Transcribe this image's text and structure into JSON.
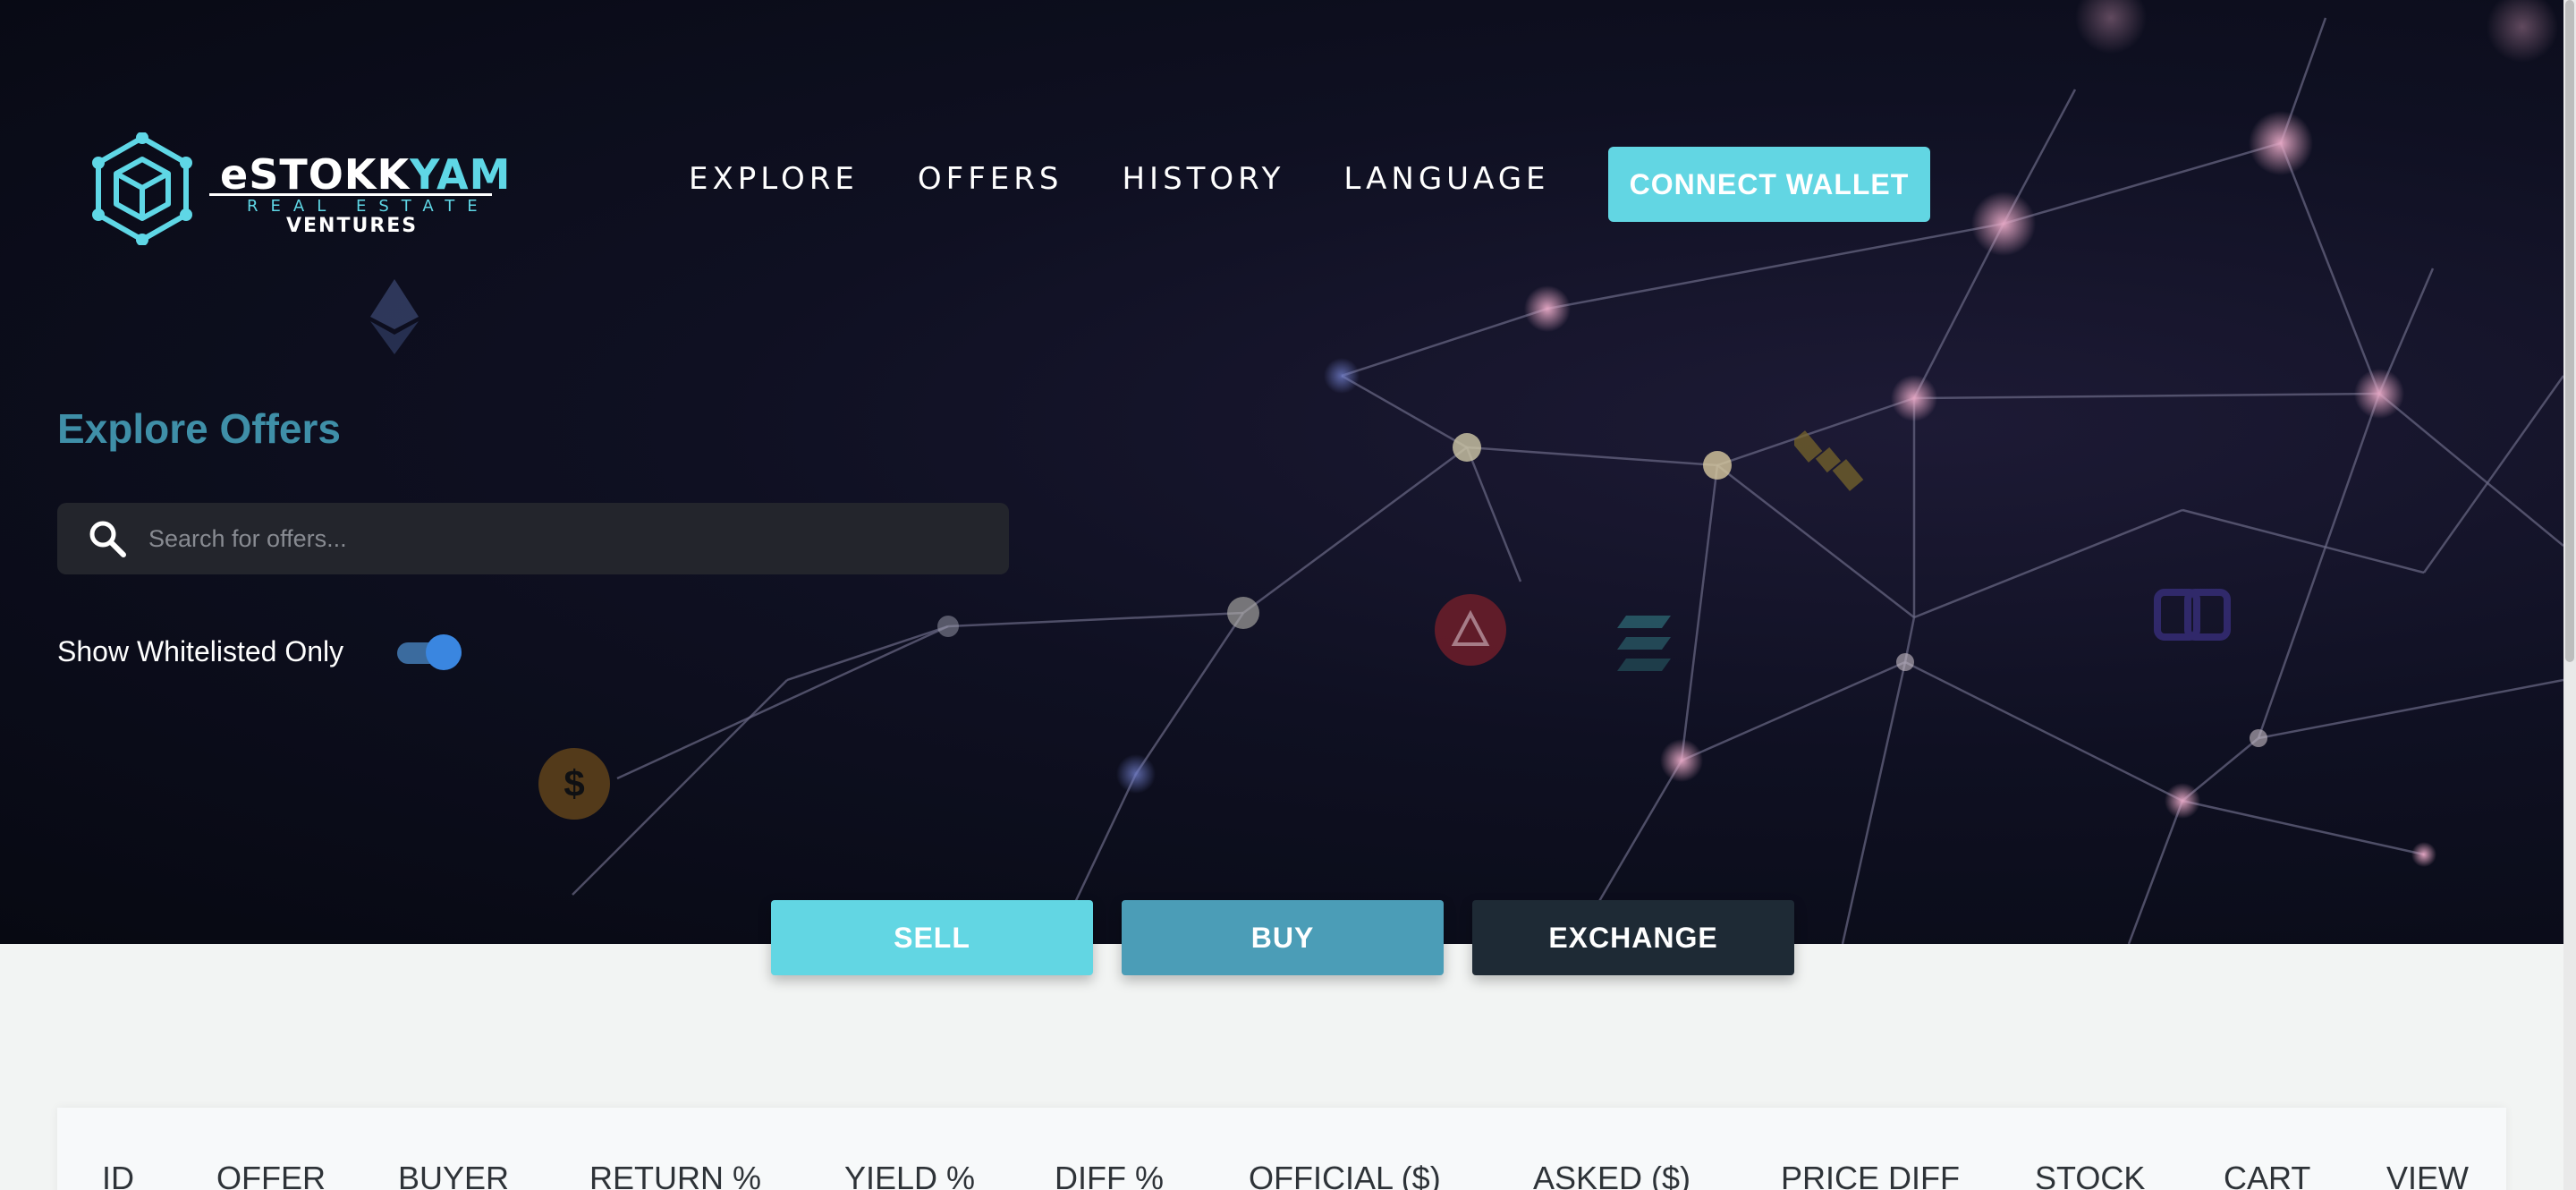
{
  "brand": {
    "word_main": "eSTOKK",
    "word_accent": "YAM",
    "sub": "REAL ESTATE",
    "ventures": "VENTURES"
  },
  "nav": {
    "items": [
      "EXPLORE",
      "OFFERS",
      "HISTORY",
      "LANGUAGE"
    ],
    "connect_label": "CONNECT WALLET"
  },
  "hero": {
    "title": "Explore Offers",
    "search_placeholder": "Search for offers...",
    "whitelist_label": "Show Whitelisted Only",
    "whitelist_on": true
  },
  "tabs": [
    "SELL",
    "BUY",
    "EXCHANGE"
  ],
  "table": {
    "headers": [
      "ID",
      "OFFER",
      "BUYER",
      "RETURN %",
      "YIELD %",
      "DIFF %",
      "OFFICIAL ($)",
      "ASKED ($)",
      "PRICE DIFF",
      "STOCK",
      "CART",
      "VIEW"
    ]
  },
  "colors": {
    "accent": "#62d6e3",
    "buy": "#4b9db7",
    "exchange": "#1e2a35",
    "title": "#3f8fa8",
    "toggle": "#3a86e0"
  },
  "icons": [
    "cube-logo-icon",
    "search-icon",
    "ethereum-icon",
    "dollar-coin-icon",
    "arbitrum-icon",
    "stacks-icon",
    "chainlink-icon",
    "satellite-icon"
  ]
}
